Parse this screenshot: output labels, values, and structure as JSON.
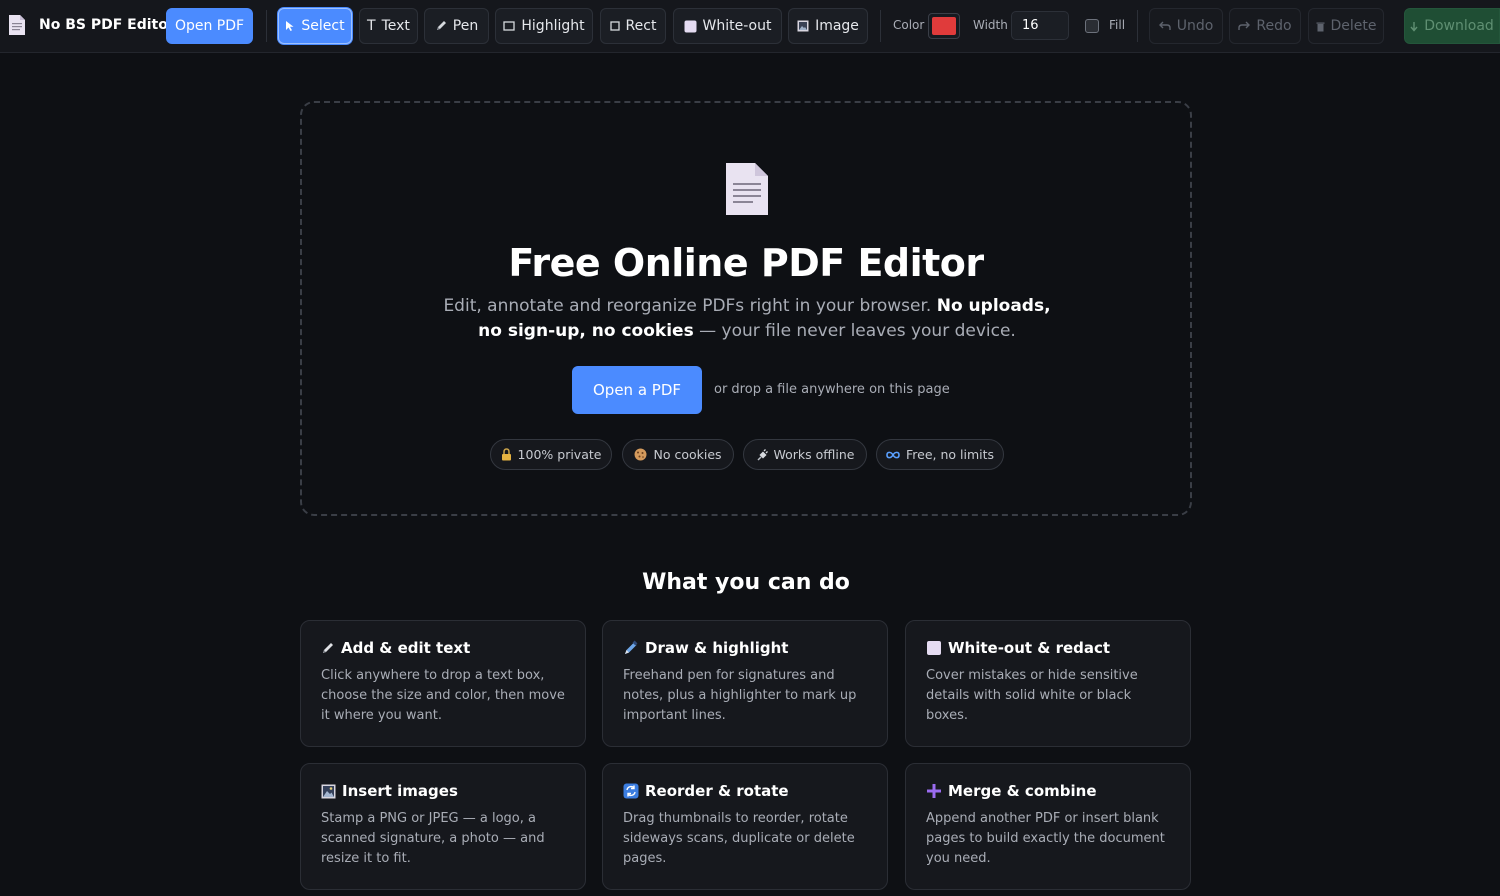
{
  "toolbar": {
    "app_name": "No BS PDF Editor",
    "open_pdf_label": "Open PDF",
    "tools": {
      "select": "Select",
      "text": "Text",
      "pen": "Pen",
      "highlight": "Highlight",
      "rect": "Rect",
      "whiteout": "White-out",
      "image": "Image"
    },
    "active_tool": "select",
    "color_label": "Color",
    "color_value": "#e03b3b",
    "width_label": "Width",
    "width_value": "16",
    "fill_label": "Fill",
    "fill_checked": false,
    "undo_label": "Undo",
    "redo_label": "Redo",
    "delete_label": "Delete",
    "download_label": "Download"
  },
  "hero": {
    "title": "Free Online PDF Editor",
    "subtitle_part1": "Edit, annotate and reorganize PDFs right in your browser.",
    "subtitle_bold": "No uploads, no sign-up, no cookies",
    "subtitle_part2": "— your file never leaves your device.",
    "open_button": "Open a PDF",
    "drop_hint": "or drop a file anywhere on this page",
    "badges": [
      {
        "label": "100% private",
        "icon": "lock-icon"
      },
      {
        "label": "No cookies",
        "icon": "cookie-icon"
      },
      {
        "label": "Works offline",
        "icon": "plug-icon"
      },
      {
        "label": "Free, no limits",
        "icon": "infinity-icon"
      }
    ]
  },
  "features": {
    "title": "What you can do",
    "cards": [
      {
        "title": "Add & edit text",
        "icon": "pencil-icon",
        "text": "Click anywhere to drop a text box, choose the size and color, then move it where you want."
      },
      {
        "title": "Draw & highlight",
        "icon": "pen-icon",
        "text": "Freehand pen for signatures and notes, plus a highlighter to mark up important lines."
      },
      {
        "title": "White-out & redact",
        "icon": "square-icon",
        "text": "Cover mistakes or hide sensitive details with solid white or black boxes."
      },
      {
        "title": "Insert images",
        "icon": "picture-icon",
        "text": "Stamp a PNG or JPEG — a logo, a scanned signature, a photo — and resize it to fit."
      },
      {
        "title": "Reorder & rotate",
        "icon": "rotate-icon",
        "text": "Drag thumbnails to reorder, rotate sideways scans, duplicate or delete pages."
      },
      {
        "title": "Merge & combine",
        "icon": "plus-icon",
        "text": "Append another PDF or insert blank pages to build exactly the document you need."
      }
    ]
  }
}
